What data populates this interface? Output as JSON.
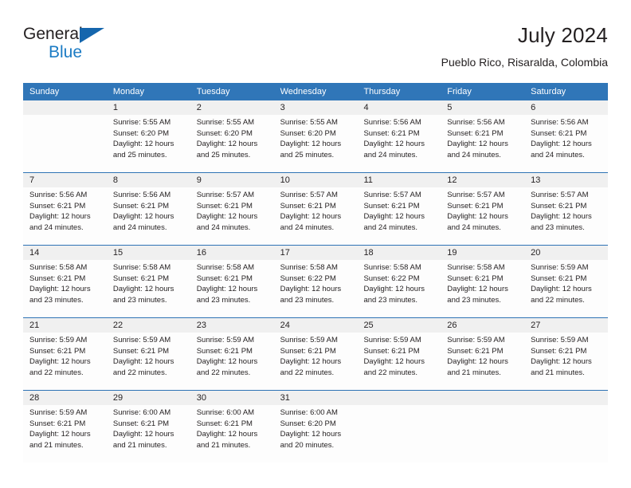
{
  "brand": {
    "name_top": "General",
    "name_bottom": "Blue",
    "accent_color": "#1b7bc4",
    "triangle_color": "#1566ad"
  },
  "header": {
    "title": "July 2024",
    "subtitle": "Pueblo Rico, Risaralda, Colombia"
  },
  "calendar": {
    "header_bg": "#3076b8",
    "row_divider_color": "#2e73b5",
    "daynum_bg": "#f0f0f0",
    "weekdays": [
      "Sunday",
      "Monday",
      "Tuesday",
      "Wednesday",
      "Thursday",
      "Friday",
      "Saturday"
    ],
    "weeks": [
      [
        {
          "day": ""
        },
        {
          "day": "1",
          "sunrise": "Sunrise: 5:55 AM",
          "sunset": "Sunset: 6:20 PM",
          "daylight": "Daylight: 12 hours and 25 minutes."
        },
        {
          "day": "2",
          "sunrise": "Sunrise: 5:55 AM",
          "sunset": "Sunset: 6:20 PM",
          "daylight": "Daylight: 12 hours and 25 minutes."
        },
        {
          "day": "3",
          "sunrise": "Sunrise: 5:55 AM",
          "sunset": "Sunset: 6:20 PM",
          "daylight": "Daylight: 12 hours and 25 minutes."
        },
        {
          "day": "4",
          "sunrise": "Sunrise: 5:56 AM",
          "sunset": "Sunset: 6:21 PM",
          "daylight": "Daylight: 12 hours and 24 minutes."
        },
        {
          "day": "5",
          "sunrise": "Sunrise: 5:56 AM",
          "sunset": "Sunset: 6:21 PM",
          "daylight": "Daylight: 12 hours and 24 minutes."
        },
        {
          "day": "6",
          "sunrise": "Sunrise: 5:56 AM",
          "sunset": "Sunset: 6:21 PM",
          "daylight": "Daylight: 12 hours and 24 minutes."
        }
      ],
      [
        {
          "day": "7",
          "sunrise": "Sunrise: 5:56 AM",
          "sunset": "Sunset: 6:21 PM",
          "daylight": "Daylight: 12 hours and 24 minutes."
        },
        {
          "day": "8",
          "sunrise": "Sunrise: 5:56 AM",
          "sunset": "Sunset: 6:21 PM",
          "daylight": "Daylight: 12 hours and 24 minutes."
        },
        {
          "day": "9",
          "sunrise": "Sunrise: 5:57 AM",
          "sunset": "Sunset: 6:21 PM",
          "daylight": "Daylight: 12 hours and 24 minutes."
        },
        {
          "day": "10",
          "sunrise": "Sunrise: 5:57 AM",
          "sunset": "Sunset: 6:21 PM",
          "daylight": "Daylight: 12 hours and 24 minutes."
        },
        {
          "day": "11",
          "sunrise": "Sunrise: 5:57 AM",
          "sunset": "Sunset: 6:21 PM",
          "daylight": "Daylight: 12 hours and 24 minutes."
        },
        {
          "day": "12",
          "sunrise": "Sunrise: 5:57 AM",
          "sunset": "Sunset: 6:21 PM",
          "daylight": "Daylight: 12 hours and 24 minutes."
        },
        {
          "day": "13",
          "sunrise": "Sunrise: 5:57 AM",
          "sunset": "Sunset: 6:21 PM",
          "daylight": "Daylight: 12 hours and 23 minutes."
        }
      ],
      [
        {
          "day": "14",
          "sunrise": "Sunrise: 5:58 AM",
          "sunset": "Sunset: 6:21 PM",
          "daylight": "Daylight: 12 hours and 23 minutes."
        },
        {
          "day": "15",
          "sunrise": "Sunrise: 5:58 AM",
          "sunset": "Sunset: 6:21 PM",
          "daylight": "Daylight: 12 hours and 23 minutes."
        },
        {
          "day": "16",
          "sunrise": "Sunrise: 5:58 AM",
          "sunset": "Sunset: 6:21 PM",
          "daylight": "Daylight: 12 hours and 23 minutes."
        },
        {
          "day": "17",
          "sunrise": "Sunrise: 5:58 AM",
          "sunset": "Sunset: 6:22 PM",
          "daylight": "Daylight: 12 hours and 23 minutes."
        },
        {
          "day": "18",
          "sunrise": "Sunrise: 5:58 AM",
          "sunset": "Sunset: 6:22 PM",
          "daylight": "Daylight: 12 hours and 23 minutes."
        },
        {
          "day": "19",
          "sunrise": "Sunrise: 5:58 AM",
          "sunset": "Sunset: 6:21 PM",
          "daylight": "Daylight: 12 hours and 23 minutes."
        },
        {
          "day": "20",
          "sunrise": "Sunrise: 5:59 AM",
          "sunset": "Sunset: 6:21 PM",
          "daylight": "Daylight: 12 hours and 22 minutes."
        }
      ],
      [
        {
          "day": "21",
          "sunrise": "Sunrise: 5:59 AM",
          "sunset": "Sunset: 6:21 PM",
          "daylight": "Daylight: 12 hours and 22 minutes."
        },
        {
          "day": "22",
          "sunrise": "Sunrise: 5:59 AM",
          "sunset": "Sunset: 6:21 PM",
          "daylight": "Daylight: 12 hours and 22 minutes."
        },
        {
          "day": "23",
          "sunrise": "Sunrise: 5:59 AM",
          "sunset": "Sunset: 6:21 PM",
          "daylight": "Daylight: 12 hours and 22 minutes."
        },
        {
          "day": "24",
          "sunrise": "Sunrise: 5:59 AM",
          "sunset": "Sunset: 6:21 PM",
          "daylight": "Daylight: 12 hours and 22 minutes."
        },
        {
          "day": "25",
          "sunrise": "Sunrise: 5:59 AM",
          "sunset": "Sunset: 6:21 PM",
          "daylight": "Daylight: 12 hours and 22 minutes."
        },
        {
          "day": "26",
          "sunrise": "Sunrise: 5:59 AM",
          "sunset": "Sunset: 6:21 PM",
          "daylight": "Daylight: 12 hours and 21 minutes."
        },
        {
          "day": "27",
          "sunrise": "Sunrise: 5:59 AM",
          "sunset": "Sunset: 6:21 PM",
          "daylight": "Daylight: 12 hours and 21 minutes."
        }
      ],
      [
        {
          "day": "28",
          "sunrise": "Sunrise: 5:59 AM",
          "sunset": "Sunset: 6:21 PM",
          "daylight": "Daylight: 12 hours and 21 minutes."
        },
        {
          "day": "29",
          "sunrise": "Sunrise: 6:00 AM",
          "sunset": "Sunset: 6:21 PM",
          "daylight": "Daylight: 12 hours and 21 minutes."
        },
        {
          "day": "30",
          "sunrise": "Sunrise: 6:00 AM",
          "sunset": "Sunset: 6:21 PM",
          "daylight": "Daylight: 12 hours and 21 minutes."
        },
        {
          "day": "31",
          "sunrise": "Sunrise: 6:00 AM",
          "sunset": "Sunset: 6:20 PM",
          "daylight": "Daylight: 12 hours and 20 minutes."
        },
        {
          "day": ""
        },
        {
          "day": ""
        },
        {
          "day": ""
        }
      ]
    ]
  }
}
